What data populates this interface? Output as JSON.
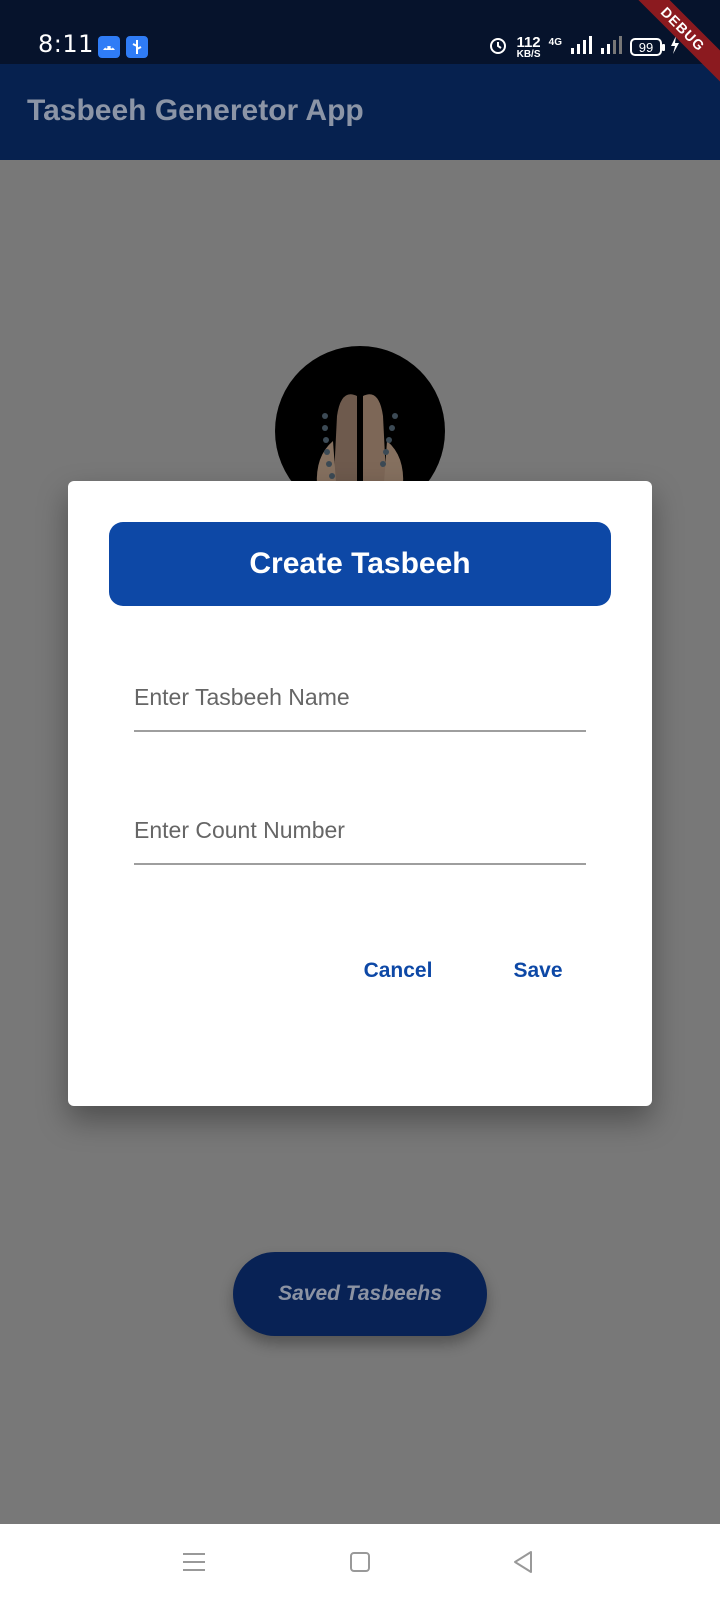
{
  "status_bar": {
    "time": "8:11",
    "net_speed": "112",
    "net_unit": "KB/S",
    "network_type": "4G",
    "battery": "99",
    "icons": [
      "android-notification-icon",
      "usb-notification-icon",
      "alarm-icon",
      "signal-icon",
      "signal-icon-2",
      "charging-icon"
    ]
  },
  "debug_banner": "DEBUG",
  "app_bar": {
    "title": "Tasbeeh Generetor App"
  },
  "home": {
    "saved_button": "Saved Tasbeehs"
  },
  "dialog": {
    "title": "Create Tasbeeh",
    "name_placeholder": "Enter Tasbeeh Name",
    "count_placeholder": "Enter Count Number",
    "cancel": "Cancel",
    "save": "Save"
  },
  "colors": {
    "primary": "#0d48a6",
    "app_bar": "#06214f",
    "scrim": "#787878"
  }
}
